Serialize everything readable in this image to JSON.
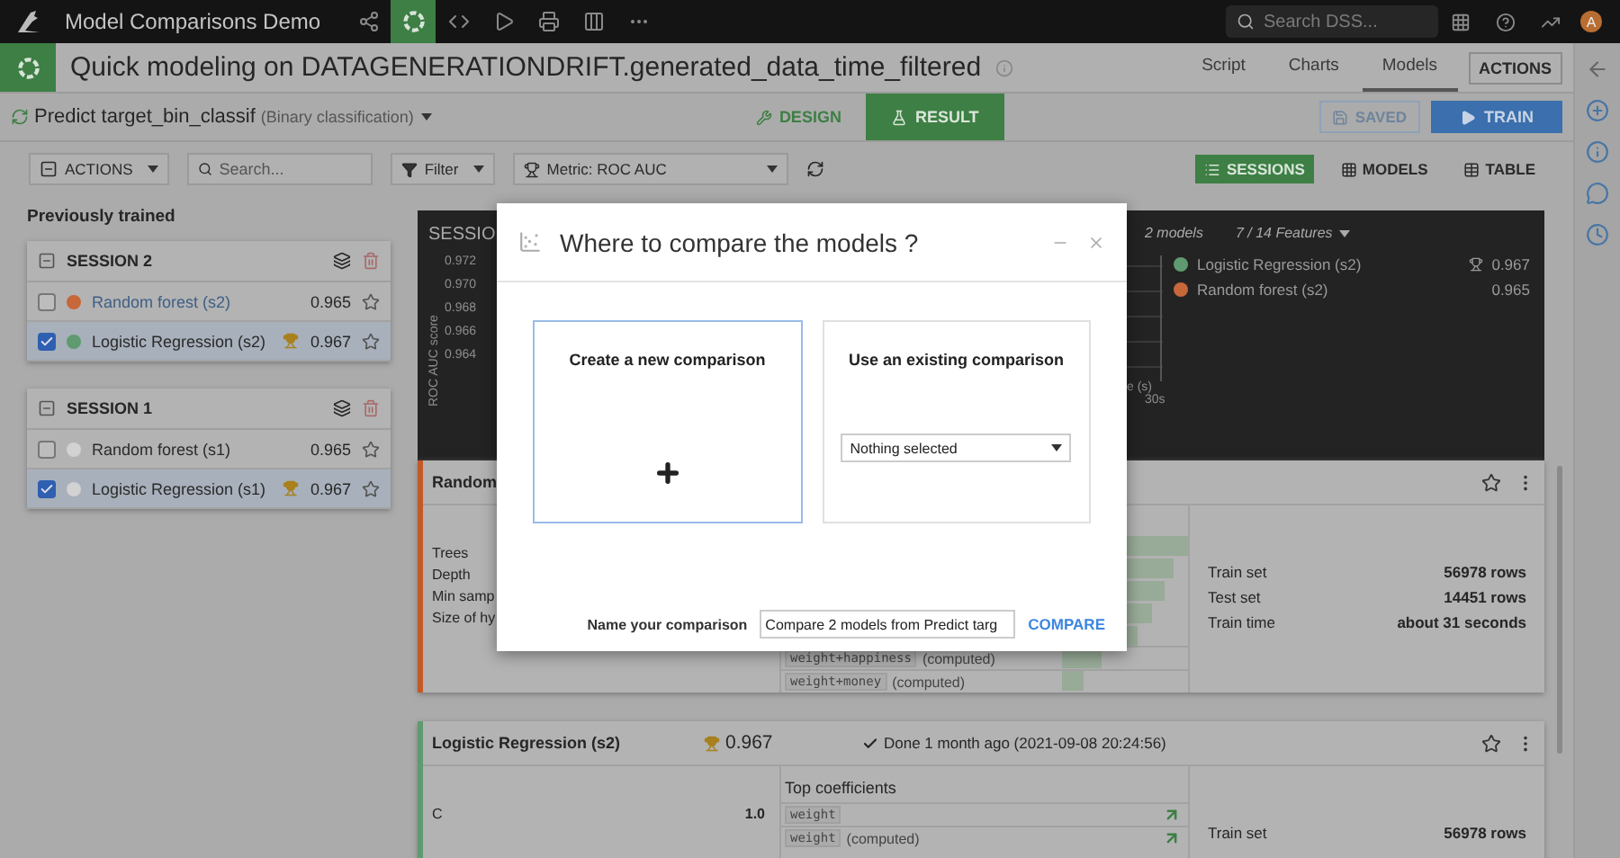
{
  "topbar": {
    "project": "Model Comparisons Demo",
    "search": {
      "placeholder": "Search DSS..."
    },
    "avatar": "A"
  },
  "header": {
    "title": "Quick modeling on DATAGENERATIONDRIFT.generated_data_time_filtered",
    "tabs": [
      {
        "label": "Script",
        "selected": false
      },
      {
        "label": "Charts",
        "selected": false
      },
      {
        "label": "Models",
        "selected": true
      }
    ],
    "actions": "ACTIONS"
  },
  "subheader": {
    "task": "Predict target_bin_classif",
    "task_type": "(Binary classification)",
    "modes": [
      {
        "label": "DESIGN",
        "selected": false
      },
      {
        "label": "RESULT",
        "selected": true
      }
    ],
    "saved": "SAVED",
    "train": "TRAIN"
  },
  "toolbar": {
    "actions": "ACTIONS",
    "search": {
      "placeholder": "Search..."
    },
    "filter": "Filter",
    "metric": "Metric: ROC AUC",
    "views": [
      {
        "label": "SESSIONS",
        "selected": true
      },
      {
        "label": "MODELS",
        "selected": false
      },
      {
        "label": "TABLE",
        "selected": false
      }
    ]
  },
  "sessions_title": "Previously trained",
  "sessions": [
    {
      "name": "SESSION 2",
      "models": [
        {
          "name": "Random forest (s2)",
          "score": "0.965",
          "best": false,
          "checked": false,
          "hovered": true,
          "color": "#c7673a"
        },
        {
          "name": "Logistic Regression (s2)",
          "score": "0.967",
          "best": true,
          "checked": true,
          "hovered": false,
          "color": "#5f9a70"
        }
      ]
    },
    {
      "name": "SESSION 1",
      "models": [
        {
          "name": "Random forest (s1)",
          "score": "0.965",
          "best": false,
          "checked": false,
          "hovered": false,
          "color": "#d2d2d2"
        },
        {
          "name": "Logistic Regression (s1)",
          "score": "0.967",
          "best": true,
          "checked": true,
          "hovered": false,
          "color": "#d2d2d2"
        }
      ]
    }
  ],
  "chart": {
    "title": "SESSIO",
    "y_label": "ROC AUC score",
    "y_ticks": [
      "0.972",
      "0.970",
      "0.968",
      "0.966",
      "0.964"
    ],
    "x_label": "e (s)",
    "x_tick": "30s",
    "models_count": "2 models",
    "features": "7 / 14 Features",
    "legend": [
      {
        "name": "Logistic Regression (s2)",
        "score": "0.967",
        "best": true,
        "color": "#5f9a70"
      },
      {
        "name": "Random forest (s2)",
        "score": "0.965",
        "best": false,
        "color": "#c7673a"
      }
    ]
  },
  "model_cards": [
    {
      "title": "Random",
      "color": "#c15a28",
      "params": [
        {
          "label": "Trees"
        },
        {
          "label": "Depth"
        },
        {
          "label": "Min samp"
        },
        {
          "label": "Size of hy"
        }
      ],
      "features": [
        {
          "name": "weight+happiness",
          "suffix": "(computed)"
        },
        {
          "name": "weight+money",
          "suffix": "(computed)"
        }
      ],
      "stats": [
        {
          "label": "Train set",
          "value": "56978 rows"
        },
        {
          "label": "Test set",
          "value": "14451 rows"
        },
        {
          "label": "Train time",
          "value": "about 31 seconds"
        }
      ]
    },
    {
      "title": "Logistic Regression (s2)",
      "color": "#5f9a70",
      "score": "0.967",
      "status": "Done 1 month ago (2021-09-08 20:24:56)",
      "features_title": "Top coefficients",
      "params": [
        {
          "label": "C",
          "value": "1.0"
        }
      ],
      "features": [
        {
          "name": "weight"
        },
        {
          "name": "weight",
          "suffix": "(computed)"
        }
      ],
      "stats": [
        {
          "label": "Train set",
          "value": "56978 rows"
        }
      ]
    }
  ],
  "modal": {
    "title": "Where to compare the models ?",
    "options": [
      {
        "kind": "new",
        "label": "Create a new comparison",
        "selected": true
      },
      {
        "kind": "existing",
        "label": "Use an existing comparison",
        "select": "Nothing selected",
        "selected": false
      }
    ],
    "name_label": "Name your comparison",
    "name_value": "Compare 2 models from Predict targ",
    "compare": "COMPARE"
  }
}
